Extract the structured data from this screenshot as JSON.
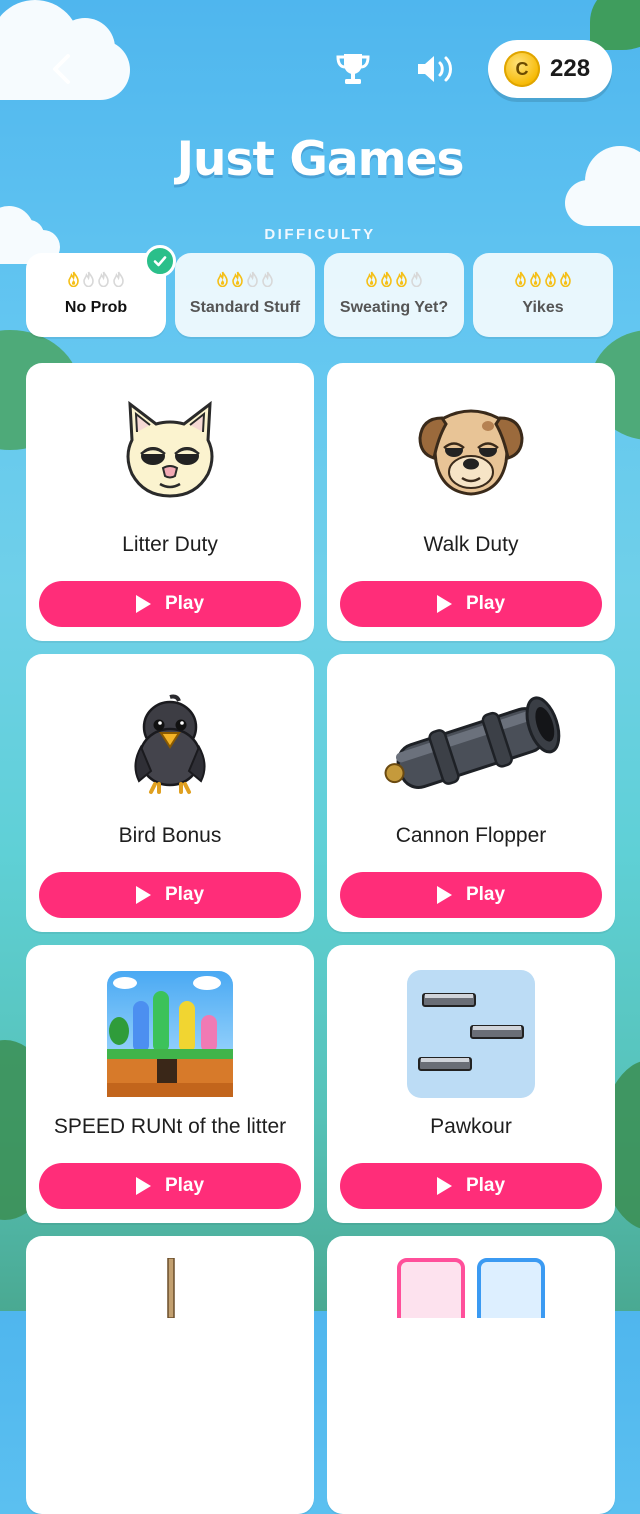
{
  "header": {
    "back_icon": "chevron-left-icon",
    "trophy_icon": "trophy-icon",
    "sound_icon": "speaker-icon",
    "coin_symbol": "C",
    "coin_count": "228"
  },
  "page_title": "Just Games",
  "difficulty": {
    "label": "DIFFICULTY",
    "options": [
      {
        "name": "No Prob",
        "level": 1,
        "selected": true
      },
      {
        "name": "Standard Stuff",
        "level": 2,
        "selected": false
      },
      {
        "name": "Sweating Yet?",
        "level": 3,
        "selected": false
      },
      {
        "name": "Yikes",
        "level": 4,
        "selected": false
      }
    ],
    "flame_on_color": "#f5bf16",
    "flame_off_color": "#d8d8d8"
  },
  "games": [
    {
      "name": "Litter Duty",
      "play_label": "Play",
      "icon": "cat-face-icon"
    },
    {
      "name": "Walk Duty",
      "play_label": "Play",
      "icon": "dog-face-icon"
    },
    {
      "name": "Bird Bonus",
      "play_label": "Play",
      "icon": "crow-icon"
    },
    {
      "name": "Cannon Flopper",
      "play_label": "Play",
      "icon": "cannon-icon"
    },
    {
      "name": "SPEED RUNt of the litter",
      "play_label": "Play",
      "icon": "platformer-thumbnail"
    },
    {
      "name": "Pawkour",
      "play_label": "Play",
      "icon": "platforms-thumbnail"
    }
  ],
  "colors": {
    "play_button": "#ff2d79",
    "check_badge": "#2bbf8a"
  }
}
